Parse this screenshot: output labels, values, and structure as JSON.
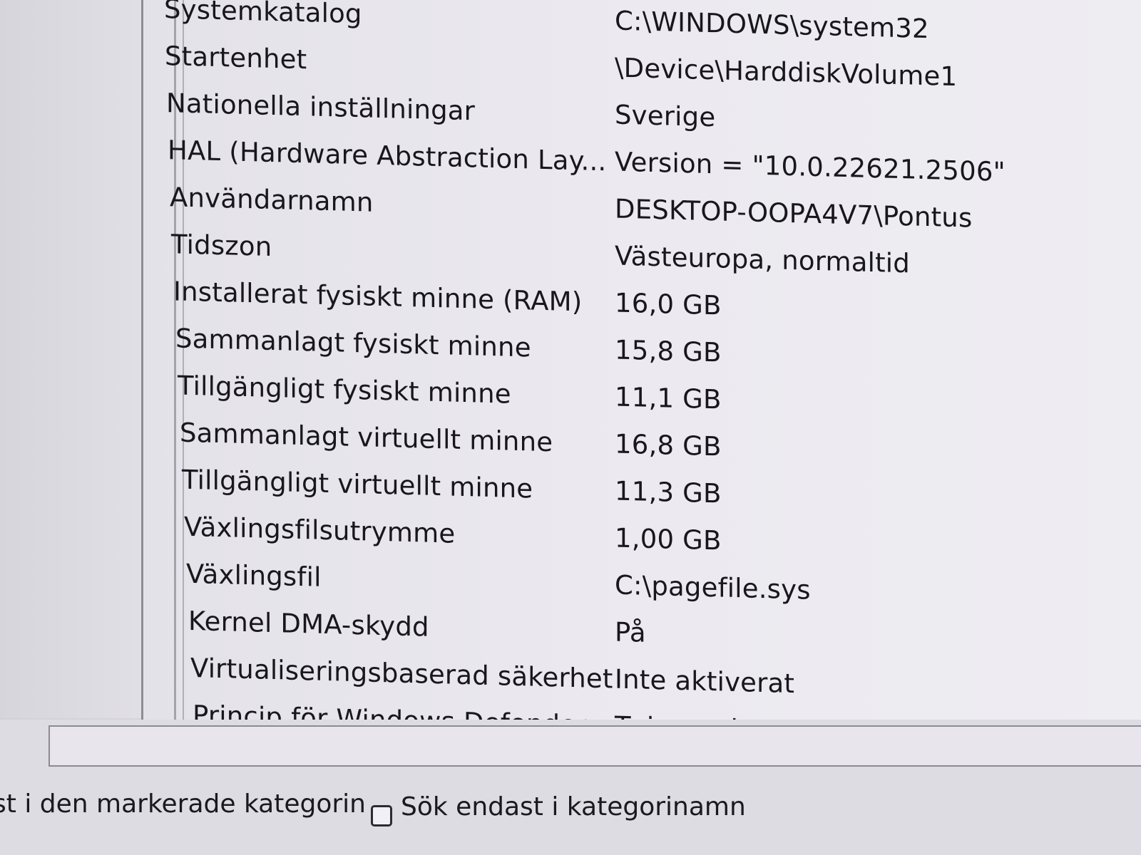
{
  "system_summary": {
    "rows": [
      {
        "name": "Systemkatalog",
        "value": "C:\\WINDOWS\\system32"
      },
      {
        "name": "Startenhet",
        "value": "\\Device\\HarddiskVolume1"
      },
      {
        "name": "Nationella inställningar",
        "value": "Sverige"
      },
      {
        "name": "HAL (Hardware Abstraction Lay...",
        "value": "Version = \"10.0.22621.2506\""
      },
      {
        "name": "Användarnamn",
        "value": "DESKTOP-OOPA4V7\\Pontus"
      },
      {
        "name": "Tidszon",
        "value": "Västeuropa, normaltid"
      },
      {
        "name": "Installerat fysiskt minne (RAM)",
        "value": "16,0 GB"
      },
      {
        "name": "Sammanlagt fysiskt minne",
        "value": "15,8 GB"
      },
      {
        "name": "Tillgängligt fysiskt minne",
        "value": "11,1 GB"
      },
      {
        "name": "Sammanlagt virtuellt minne",
        "value": "16,8 GB"
      },
      {
        "name": "Tillgängligt virtuellt minne",
        "value": "11,3 GB"
      },
      {
        "name": "Växlingsfilsutrymme",
        "value": "1,00 GB"
      },
      {
        "name": "Växlingsfil",
        "value": "C:\\pagefile.sys"
      },
      {
        "name": "Kernel DMA-skydd",
        "value": "På"
      },
      {
        "name": "Virtualiseringsbaserad säkerhet",
        "value": "Inte aktiverat"
      },
      {
        "name": "Princip för Windows Defender-...",
        "value": "Tvingande"
      }
    ]
  },
  "search": {
    "value": "",
    "selected_category_option": "st i den markerade kategorin",
    "category_names_option": "Sök endast i kategorinamn",
    "category_names_checked": false
  }
}
